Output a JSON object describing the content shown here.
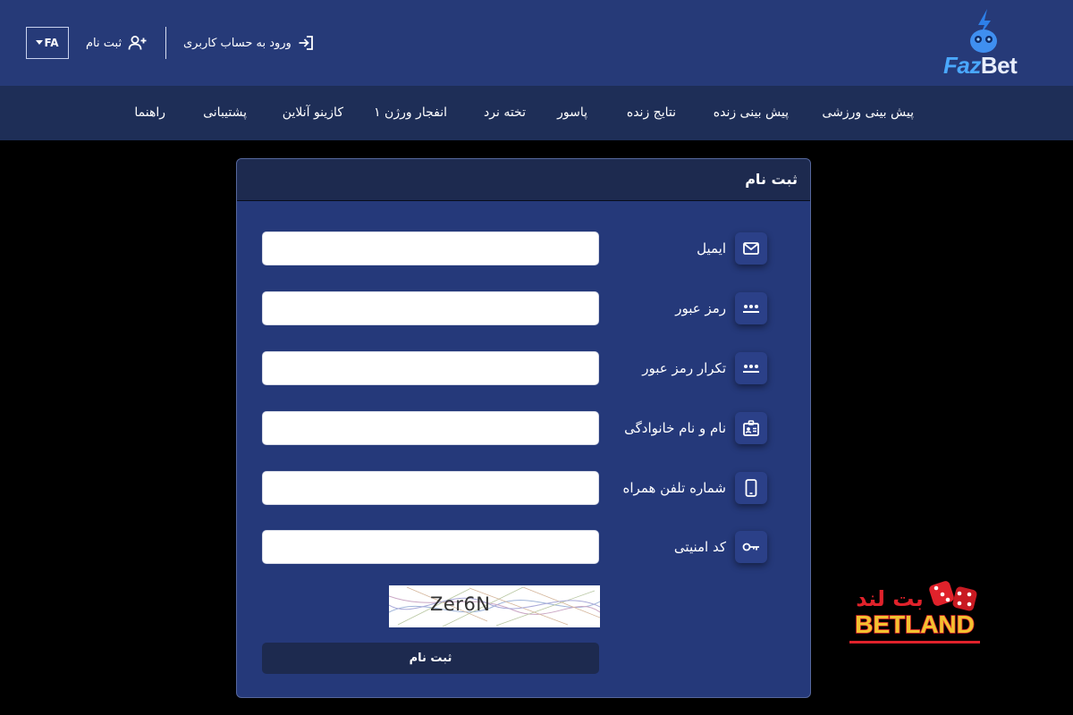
{
  "header": {
    "logo_text_part1": "Faz",
    "logo_text_part2": "Bet",
    "language_label": "FA",
    "login_label": "ورود به حساب کاربری",
    "register_label": "ثبت نام"
  },
  "nav": {
    "items": [
      "پیش بینی ورزشی",
      "پیش بینی زنده",
      "نتایج زنده",
      "پاسور",
      "تخته نرد",
      "انفجار ورژن ۱",
      "کازینو آنلاین",
      "پشتیبانی",
      "راهنما"
    ]
  },
  "form": {
    "title": "ثبت نام",
    "fields": [
      {
        "label": "ایمیل",
        "icon": "envelope-icon",
        "value": ""
      },
      {
        "label": "رمز عبور",
        "icon": "password-dots-icon",
        "value": ""
      },
      {
        "label": "تکرار رمز عبور",
        "icon": "password-dots-icon",
        "value": ""
      },
      {
        "label": "نام و نام خانوادگی",
        "icon": "id-card-icon",
        "value": ""
      },
      {
        "label": "شماره تلفن همراه",
        "icon": "mobile-phone-icon",
        "value": ""
      },
      {
        "label": "کد امنیتی",
        "icon": "key-icon",
        "value": ""
      }
    ],
    "captcha_text": "Zer6N",
    "submit_label": "ثبت نام"
  },
  "watermark": {
    "text_fa": "بت لند",
    "text_en": "BETLAND"
  },
  "colors": {
    "header_bg": "#263a78",
    "nav_bg": "#1e2e57",
    "card_bg": "#25397a",
    "card_head_bg": "#1d2a4f",
    "page_bg": "#000000",
    "logo_accent": "#4aa8ff",
    "watermark_red": "#e0222b",
    "watermark_gold": "#f2c230"
  }
}
